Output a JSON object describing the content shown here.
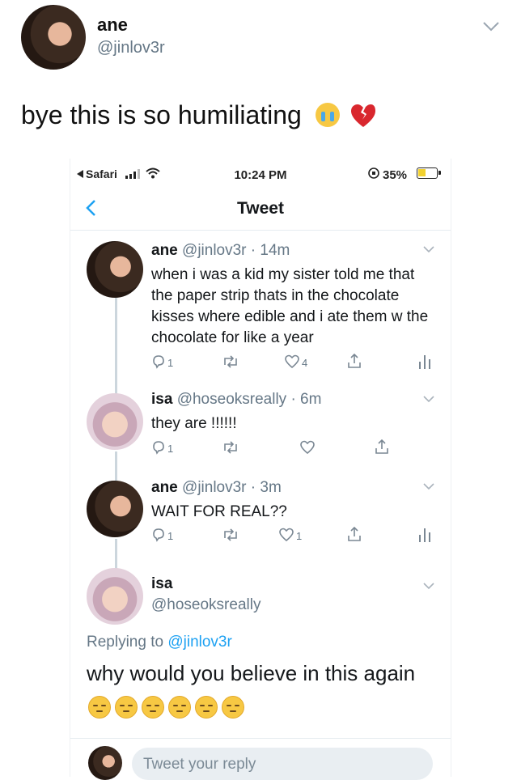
{
  "post": {
    "name": "ane",
    "handle": "@jinlov3r",
    "text": "bye this is so humiliating"
  },
  "statusbar": {
    "back_app": "Safari",
    "time": "10:24 PM",
    "battery": "35%"
  },
  "nav": {
    "title": "Tweet"
  },
  "thread": [
    {
      "name": "ane",
      "meta": "@jinlov3r · 14m",
      "text": "when i was a kid my sister told me that the paper strip thats in the chocolate kisses where edible and i ate them w the chocolate for like a year",
      "reply_count": "1",
      "like_count": "4"
    },
    {
      "name": "isa",
      "meta": "@hoseoksreally · 6m",
      "text": "they are !!!!!!",
      "reply_count": "1",
      "like_count": ""
    },
    {
      "name": "ane",
      "meta": "@jinlov3r · 3m",
      "text": "WAIT FOR REAL??",
      "reply_count": "1",
      "like_count": "1"
    }
  ],
  "focused": {
    "name": "isa",
    "handle": "@hoseoksreally",
    "replying_prefix": "Replying to ",
    "replying_to": "@jinlov3r",
    "text": "why would you believe in this again"
  },
  "reply_box": {
    "placeholder": "Tweet your reply"
  },
  "colors": {
    "link": "#1da1f2",
    "muted": "#657786",
    "border": "#e6ecf0"
  }
}
